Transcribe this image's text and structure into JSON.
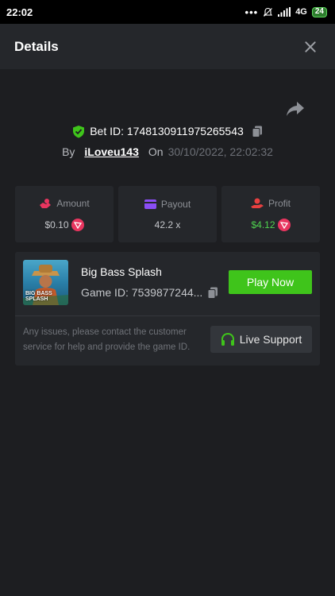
{
  "statusbar": {
    "time": "22:02",
    "network": "4G",
    "battery": "24"
  },
  "header": {
    "title": "Details"
  },
  "bet": {
    "id_label": "Bet ID: 1748130911975265543",
    "by_label": "By",
    "username": "iLoveu143",
    "on_label": "On",
    "date": "30/10/2022, 22:02:32"
  },
  "stats": {
    "amount": {
      "label": "Amount",
      "value": "$0.10"
    },
    "payout": {
      "label": "Payout",
      "value": "42.2 x"
    },
    "profit": {
      "label": "Profit",
      "value": "$4.12"
    }
  },
  "game": {
    "name": "Big Bass Splash",
    "id_label": "Game ID: 7539877244...",
    "thumb_text": "BIG BASS SPLASH",
    "play_label": "Play Now",
    "issue_text": "Any issues, please contact the customer service for help and provide the game ID.",
    "support_label": "Live Support"
  },
  "colors": {
    "accent_green": "#3fc41b",
    "profit_green": "#4fd34f",
    "coin": "#e8355f"
  }
}
